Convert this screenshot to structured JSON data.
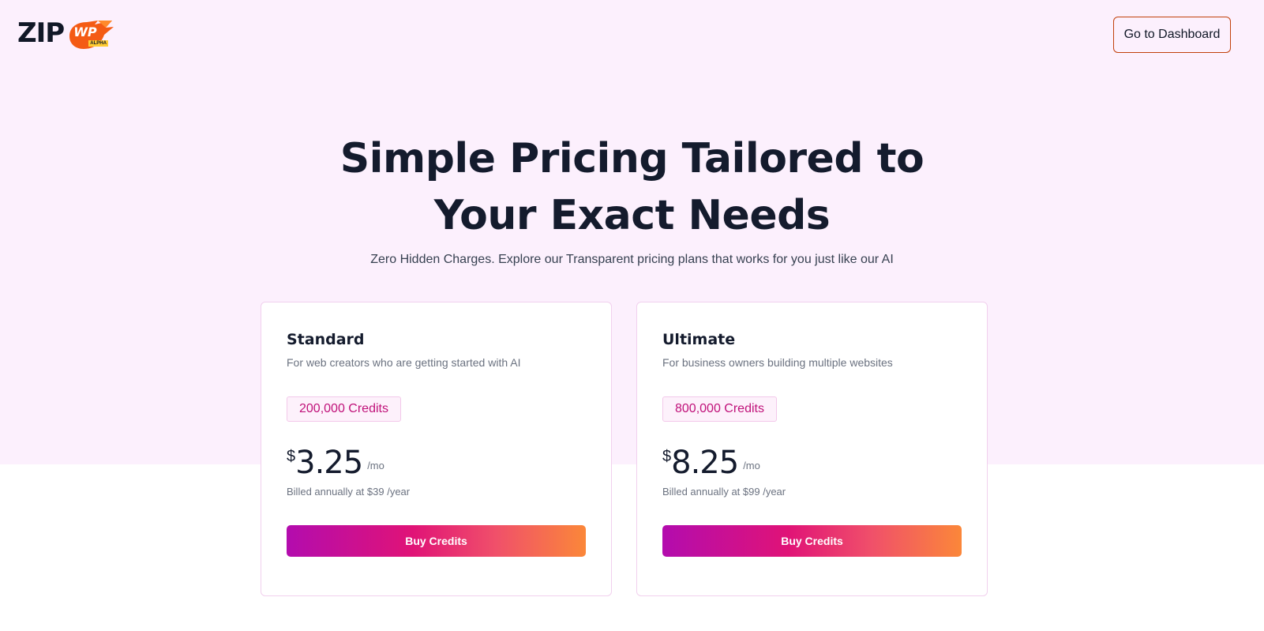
{
  "header": {
    "logo_text": "ZIP",
    "logo_badge": "WP",
    "logo_tag": "ALPHA",
    "dashboard_button": "Go to Dashboard"
  },
  "hero": {
    "title_line1": "Simple Pricing Tailored to",
    "title_line2": "Your Exact Needs",
    "subtitle": "Zero Hidden Charges. Explore our Transparent pricing plans that works for you just like our AI"
  },
  "plans": [
    {
      "name": "Standard",
      "description": "For web creators who are getting started with AI",
      "credits": "200,000 Credits",
      "currency": "$",
      "price": "3.25",
      "period": "/mo",
      "billed": "Billed annually at $39 /year",
      "button": "Buy Credits"
    },
    {
      "name": "Ultimate",
      "description": "For business owners building multiple websites",
      "credits": "800,000 Credits",
      "currency": "$",
      "price": "8.25",
      "period": "/mo",
      "billed": "Billed annually at $99 /year",
      "button": "Buy Credits"
    }
  ],
  "colors": {
    "hero_background": "#fcf0fd",
    "accent_start": "#b30cae",
    "accent_end": "#fb8739",
    "credits_text": "#c0127a"
  }
}
